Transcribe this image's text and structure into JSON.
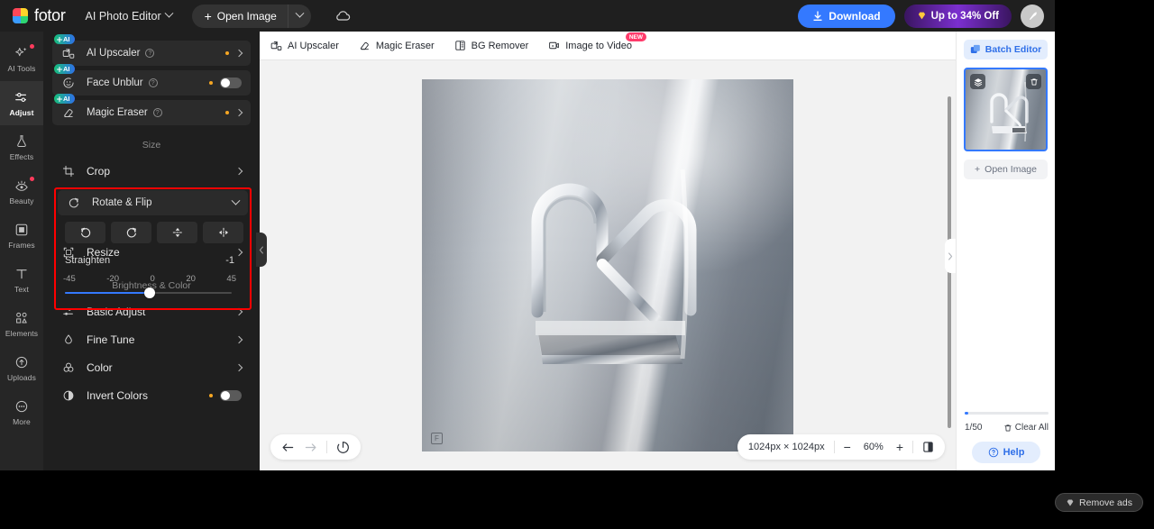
{
  "topbar": {
    "brand": "fotor",
    "app_switcher": "AI Photo Editor",
    "open_image": "Open Image",
    "download": "Download",
    "promo": "Up to 34% Off",
    "icons": {
      "cloud": "cloud-icon",
      "avatar": "avatar-bird-icon"
    }
  },
  "rail": {
    "items": [
      {
        "label": "AI Tools",
        "icon": "sparkle-icon",
        "active": false,
        "badge": true
      },
      {
        "label": "Adjust",
        "icon": "sliders-icon",
        "active": true,
        "badge": false
      },
      {
        "label": "Effects",
        "icon": "flask-icon",
        "active": false,
        "badge": false
      },
      {
        "label": "Beauty",
        "icon": "eye-icon",
        "active": false,
        "badge": true
      },
      {
        "label": "Frames",
        "icon": "frame-icon",
        "active": false,
        "badge": false
      },
      {
        "label": "Text",
        "icon": "text-icon",
        "active": false,
        "badge": false
      },
      {
        "label": "Elements",
        "icon": "shapes-icon",
        "active": false,
        "badge": false
      },
      {
        "label": "Uploads",
        "icon": "upload-cloud-icon",
        "active": false,
        "badge": false
      },
      {
        "label": "More",
        "icon": "ellipsis-circle-icon",
        "active": false,
        "badge": false
      }
    ]
  },
  "panel": {
    "ai_rows": [
      {
        "badge": "AI",
        "label": "AI Upscaler",
        "icon": "upscale-icon",
        "control": "chevron"
      },
      {
        "badge": "AI",
        "label": "Face Unblur",
        "icon": "face-icon",
        "control": "toggle"
      },
      {
        "badge": "AI",
        "label": "Magic Eraser",
        "icon": "eraser-icon",
        "control": "chevron"
      }
    ],
    "size_section": "Size",
    "crop": {
      "label": "Crop",
      "icon": "crop-icon"
    },
    "rotate_flip": {
      "label": "Rotate & Flip",
      "icon": "rotate-icon",
      "buttons": [
        {
          "name": "rotate-right-button",
          "glyph": "rotate-cw-icon"
        },
        {
          "name": "rotate-left-button",
          "glyph": "rotate-ccw-icon"
        },
        {
          "name": "flip-vertical-button",
          "glyph": "flip-vertical-icon"
        },
        {
          "name": "flip-horizontal-button",
          "glyph": "flip-horizontal-icon"
        }
      ],
      "straighten_label": "Straighten",
      "straighten_value": "-1",
      "ticks": [
        "-45",
        "-20",
        "0",
        "20",
        "45"
      ],
      "slider_min": -45,
      "slider_max": 45,
      "slider_value": -1,
      "accent": "#3479ff",
      "highlight_color": "#ff0000"
    },
    "resize": {
      "label": "Resize",
      "icon": "resize-icon"
    },
    "brightness_section": "Brightness & Color",
    "color_rows": [
      {
        "label": "Basic Adjust",
        "icon": "sliders-icon",
        "control": "chevron"
      },
      {
        "label": "Fine Tune",
        "icon": "droplet-icon",
        "control": "chevron"
      },
      {
        "label": "Color",
        "icon": "color-circles-icon",
        "control": "chevron"
      },
      {
        "label": "Invert Colors",
        "icon": "invert-icon",
        "control": "toggle"
      }
    ]
  },
  "canvas": {
    "tools": [
      {
        "label": "AI Upscaler",
        "icon": "upscale-icon",
        "new": false
      },
      {
        "label": "Magic Eraser",
        "icon": "eraser-icon",
        "new": false
      },
      {
        "label": "BG Remover",
        "icon": "bg-remover-icon",
        "new": false
      },
      {
        "label": "Image to Video",
        "icon": "image-to-video-icon",
        "new": true,
        "new_label": "NEW"
      }
    ],
    "bottom_left": {
      "undo": "undo-icon",
      "redo": "redo-icon",
      "reset": "reset-icon"
    },
    "bottom_right": {
      "dimensions": "1024px × 1024px",
      "zoom_out": "−",
      "zoom_level": "60%",
      "zoom_in": "+",
      "compare": "compare-icon"
    },
    "image": {
      "watermark": "fotor-watermark-icon"
    }
  },
  "right_panel": {
    "batch_editor": "Batch Editor",
    "open_image": "Open Image",
    "thumb_buttons": {
      "layers": "layers-icon",
      "delete": "trash-icon"
    },
    "count": "1/50",
    "clear_all": "Clear All",
    "help": "Help"
  },
  "footer": {
    "remove_ads": "Remove ads"
  }
}
